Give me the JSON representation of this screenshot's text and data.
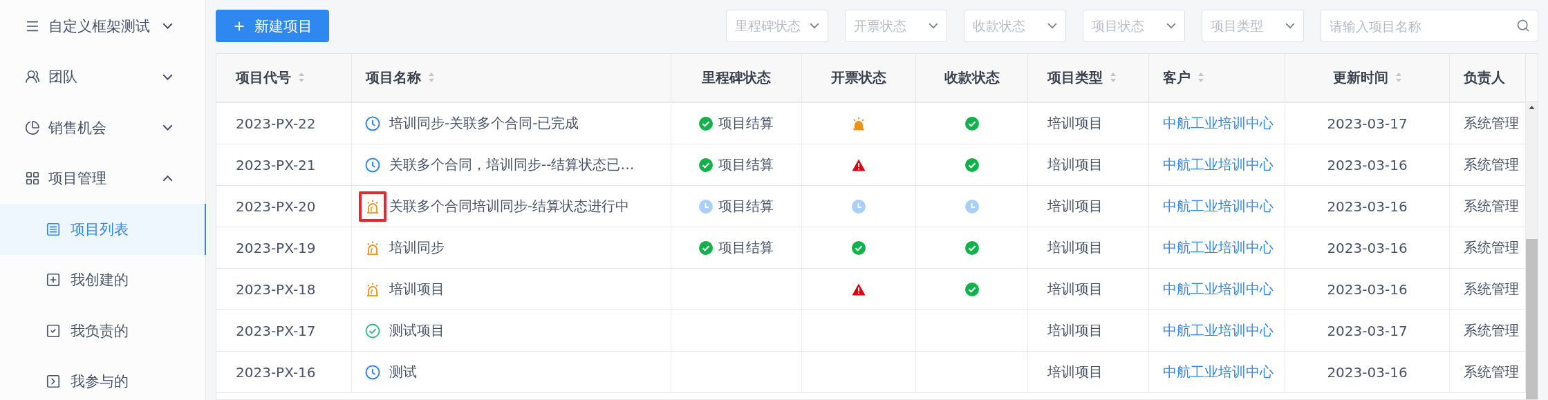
{
  "sidebar": {
    "items": [
      {
        "kind": "group",
        "label": "自定义框架测试",
        "expanded": false,
        "selected": false
      },
      {
        "kind": "group",
        "label": "团队",
        "expanded": false,
        "selected": false
      },
      {
        "kind": "group",
        "label": "销售机会",
        "expanded": false,
        "selected": false
      },
      {
        "kind": "group",
        "label": "项目管理",
        "expanded": true,
        "selected": false
      },
      {
        "kind": "sub",
        "label": "项目列表",
        "selected": true
      },
      {
        "kind": "sub",
        "label": "我创建的",
        "selected": false
      },
      {
        "kind": "sub",
        "label": "我负责的",
        "selected": false
      },
      {
        "kind": "sub",
        "label": "我参与的",
        "selected": false
      }
    ]
  },
  "toolbar": {
    "new_button": "新建项目",
    "filters": [
      {
        "placeholder": "里程碑状态"
      },
      {
        "placeholder": "开票状态"
      },
      {
        "placeholder": "收款状态"
      },
      {
        "placeholder": "项目状态"
      },
      {
        "placeholder": "项目类型"
      }
    ],
    "search": {
      "placeholder": "请输入项目名称"
    }
  },
  "table": {
    "columns": [
      {
        "label": "项目代号",
        "sortable": true
      },
      {
        "label": "项目名称",
        "sortable": true
      },
      {
        "label": "里程碑状态",
        "sortable": false
      },
      {
        "label": "开票状态",
        "sortable": false
      },
      {
        "label": "收款状态",
        "sortable": false
      },
      {
        "label": "项目类型",
        "sortable": true
      },
      {
        "label": "客户",
        "sortable": true
      },
      {
        "label": "更新时间",
        "sortable": true
      },
      {
        "label": "负责人",
        "sortable": false
      }
    ],
    "rows": [
      {
        "code": "2023-PX-22",
        "name_icon": {
          "kind": "clock"
        },
        "highlighted": false,
        "name": "培训同步-关联多个合同-已完成",
        "milestone": {
          "kind": "done",
          "label": "项目结算"
        },
        "invoice": {
          "kind": "alarm"
        },
        "payment": {
          "kind": "done"
        },
        "type": "培训项目",
        "customer": "中航工业培训中心",
        "updated": "2023-03-17",
        "owner": "系统管理"
      },
      {
        "code": "2023-PX-21",
        "name_icon": {
          "kind": "clock"
        },
        "highlighted": false,
        "name": "关联多个合同，培训同步--结算状态已…",
        "milestone": {
          "kind": "done",
          "label": "项目结算"
        },
        "invoice": {
          "kind": "warning"
        },
        "payment": {
          "kind": "done"
        },
        "type": "培训项目",
        "customer": "中航工业培训中心",
        "updated": "2023-03-16",
        "owner": "系统管理"
      },
      {
        "code": "2023-PX-20",
        "name_icon": {
          "kind": "alarm"
        },
        "highlighted": true,
        "name": "关联多个合同培训同步-结算状态进行中",
        "milestone": {
          "kind": "pending",
          "label": "项目结算"
        },
        "invoice": {
          "kind": "pending"
        },
        "payment": {
          "kind": "pending"
        },
        "type": "培训项目",
        "customer": "中航工业培训中心",
        "updated": "2023-03-16",
        "owner": "系统管理"
      },
      {
        "code": "2023-PX-19",
        "name_icon": {
          "kind": "alarm"
        },
        "highlighted": false,
        "name": "培训同步",
        "milestone": {
          "kind": "done",
          "label": "项目结算"
        },
        "invoice": {
          "kind": "done"
        },
        "payment": {
          "kind": "done"
        },
        "type": "培训项目",
        "customer": "中航工业培训中心",
        "updated": "2023-03-16",
        "owner": "系统管理"
      },
      {
        "code": "2023-PX-18",
        "name_icon": {
          "kind": "alarm"
        },
        "highlighted": false,
        "name": "培训项目",
        "invoice": {
          "kind": "warning"
        },
        "payment": {
          "kind": "done"
        },
        "type": "培训项目",
        "customer": "中航工业培训中心",
        "updated": "2023-03-16",
        "owner": "系统管理"
      },
      {
        "code": "2023-PX-17",
        "name_icon": {
          "kind": "check"
        },
        "highlighted": false,
        "name": "测试项目",
        "type": "培训项目",
        "customer": "中航工业培训中心",
        "updated": "2023-03-17",
        "owner": "系统管理"
      },
      {
        "code": "2023-PX-16",
        "name_icon": {
          "kind": "clock"
        },
        "highlighted": false,
        "name": "测试",
        "type": "培训项目",
        "customer": "中航工业培训中心",
        "updated": "2023-03-16",
        "owner": "系统管理"
      }
    ]
  }
}
